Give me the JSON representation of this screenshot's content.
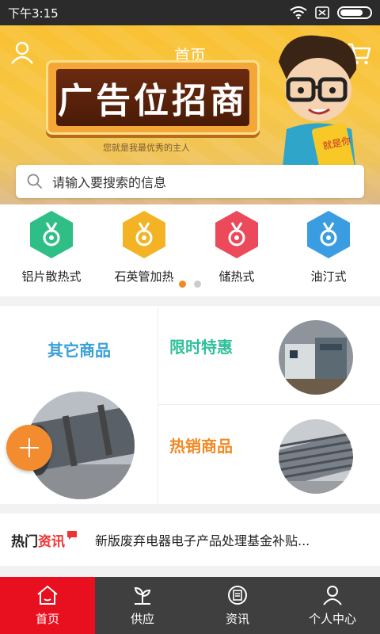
{
  "status": {
    "time": "下午3:15"
  },
  "header": {
    "title": "首页",
    "icons": [
      "user-icon",
      "cart-icon"
    ]
  },
  "banner": {
    "ad_text": "广告位招商",
    "ad_sub": "您就是我最优秀的主人",
    "mascot_card_text": "就是你"
  },
  "search": {
    "placeholder": "请输入要搜索的信息"
  },
  "categories": [
    {
      "label": "铝片散热式",
      "color": "#2fbf86"
    },
    {
      "label": "石英管加热",
      "color": "#f3b324"
    },
    {
      "label": "储热式",
      "color": "#ec4a5b"
    },
    {
      "label": "油汀式",
      "color": "#3a9de2"
    }
  ],
  "pager": {
    "active_index": 0,
    "count": 2
  },
  "sections": {
    "other": {
      "title": "其它商品",
      "color": "#3aa0d8"
    },
    "limited": {
      "title": "限时特惠",
      "color": "#2fbf9a"
    },
    "hot": {
      "title": "热销商品",
      "color": "#f08a24"
    }
  },
  "news": {
    "logo_a": "热门",
    "logo_b": "资讯",
    "headline": "新版废弃电器电子产品处理基金补贴..."
  },
  "tabs": [
    {
      "label": "首页",
      "icon": "home-icon",
      "active": true
    },
    {
      "label": "供应",
      "icon": "supply-icon",
      "active": false
    },
    {
      "label": "资讯",
      "icon": "news-icon",
      "active": false
    },
    {
      "label": "个人中心",
      "icon": "profile-icon",
      "active": false
    }
  ],
  "colors": {
    "accent": "#e8101f",
    "fab": "#f28c2e"
  }
}
